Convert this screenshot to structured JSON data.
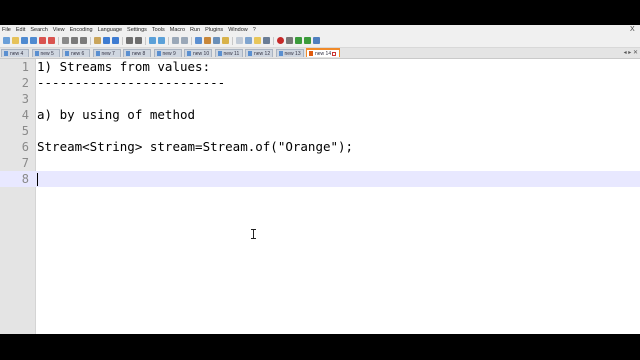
{
  "menu": [
    "File",
    "Edit",
    "Search",
    "View",
    "Encoding",
    "Language",
    "Settings",
    "Tools",
    "Macro",
    "Run",
    "Plugins",
    "Window",
    "?"
  ],
  "window_controls": {
    "close": "X"
  },
  "toolbar_icons": [
    "new-icon",
    "open-icon",
    "save-icon",
    "save-all-icon",
    "close-icon",
    "close-all-icon",
    "print-icon",
    "cut-icon",
    "copy-icon",
    "paste-icon",
    "undo-icon",
    "redo-icon",
    "find-icon",
    "replace-icon",
    "zoom-in-icon",
    "zoom-out-icon",
    "sync-v-icon",
    "sync-h-icon",
    "word-wrap-icon",
    "show-all-icon",
    "indent-guide-icon",
    "lang-icon",
    "doc-map-icon",
    "function-list-icon",
    "folder-icon",
    "monitor-icon",
    "record-icon",
    "stop-icon",
    "play-icon",
    "play-multi-icon",
    "save-macro-icon"
  ],
  "tabs": [
    {
      "label": "new 4"
    },
    {
      "label": "new 5"
    },
    {
      "label": "new 6"
    },
    {
      "label": "new 7"
    },
    {
      "label": "new 8"
    },
    {
      "label": "new 9"
    },
    {
      "label": "new 10"
    },
    {
      "label": "new 11"
    },
    {
      "label": "new 12"
    },
    {
      "label": "new 13"
    },
    {
      "label": "new 14",
      "active": true
    }
  ],
  "tab_nav": "◂ ▸ ✕",
  "editor": {
    "lines": [
      {
        "num": "1",
        "text": "1) Streams from values:"
      },
      {
        "num": "2",
        "text": "-------------------------"
      },
      {
        "num": "3",
        "text": ""
      },
      {
        "num": "4",
        "text": "a) by using of method"
      },
      {
        "num": "5",
        "text": ""
      },
      {
        "num": "6",
        "text": "Stream<String> stream=Stream.of(\"Orange\");"
      },
      {
        "num": "7",
        "text": ""
      },
      {
        "num": "8",
        "text": "",
        "current": true
      }
    ]
  },
  "colors": {
    "accent_tab": "#f08a2a",
    "current_line": "#e8e8ff",
    "gutter": "#e4e4e4"
  }
}
